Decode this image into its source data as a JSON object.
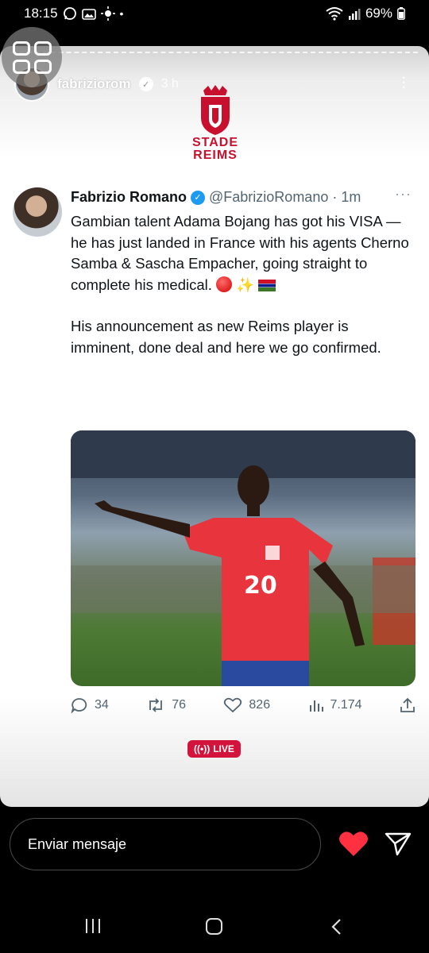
{
  "status_bar": {
    "time": "18:15",
    "notification_icons": [
      "whatsapp-icon",
      "gallery-icon",
      "brightness-icon",
      "dot-icon"
    ],
    "battery_percent": "69%",
    "system_icons": [
      "wifi-icon",
      "signal-icon",
      "battery-icon"
    ]
  },
  "story": {
    "username": "fabriziorom",
    "time_ago": "3 h",
    "logo": {
      "line1": "STADE",
      "line2": "REIMS"
    },
    "progress_segments": 1
  },
  "tweet": {
    "name": "Fabrizio Romano",
    "handle": "@FabrizioRomano",
    "time": "· 1m",
    "more": "···",
    "paragraph1": "Gambian talent Adama Bojang has got his VISA — he has just landed in France with his agents Cherno Samba & Sascha Empacher, going straight to complete his medical.",
    "paragraph2": "His announcement as new Reims player is imminent, done deal and here we go confirmed.",
    "image_alt": "player-photo",
    "shirt_number": "20",
    "metrics": {
      "replies": "34",
      "retweets": "76",
      "likes": "826",
      "views": "7.174"
    }
  },
  "live_badge": "LIVE",
  "message_bar": {
    "placeholder": "Enviar mensaje"
  },
  "colors": {
    "reims_red": "#c8102e",
    "twitter_blue": "#1d9bf0",
    "live_red": "#d3133c",
    "heart_red": "#ff3040"
  }
}
